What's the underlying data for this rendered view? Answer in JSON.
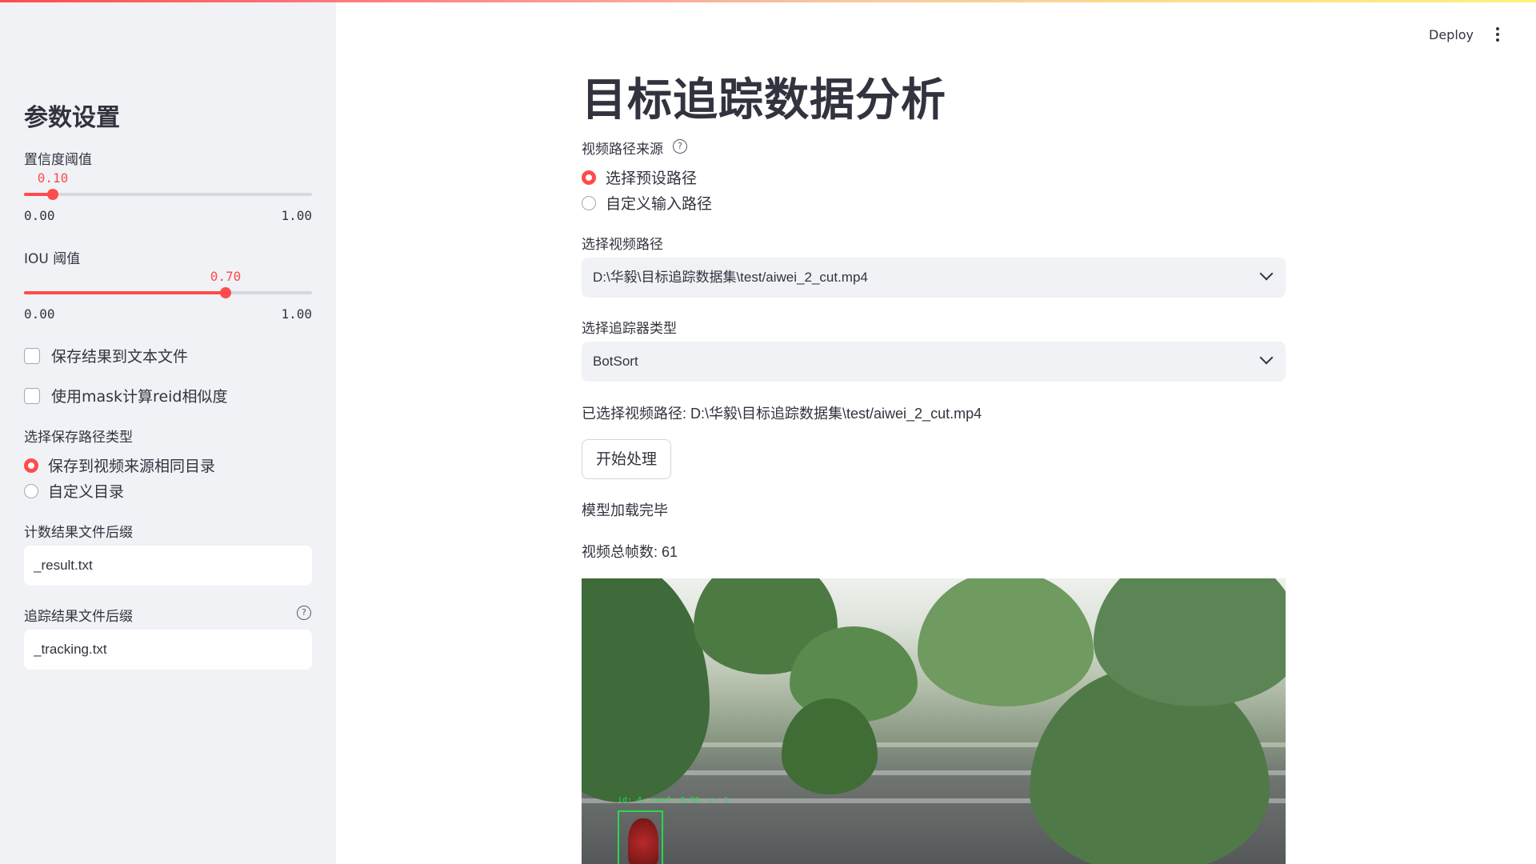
{
  "sidebar": {
    "title": "参数设置",
    "confidence": {
      "label": "置信度阈值",
      "value": 0.1,
      "value_text": "0.10",
      "min_text": "0.00",
      "max_text": "1.00"
    },
    "iou": {
      "label": "IOU 阈值",
      "value": 0.7,
      "value_text": "0.70",
      "min_text": "0.00",
      "max_text": "1.00"
    },
    "checkboxes": [
      {
        "label": "保存结果到文本文件",
        "checked": false
      },
      {
        "label": "使用mask计算reid相似度",
        "checked": false
      }
    ],
    "save_path_type": {
      "label": "选择保存路径类型",
      "options": [
        "保存到视频来源相同目录",
        "自定义目录"
      ],
      "selected": 0
    },
    "count_suffix": {
      "label": "计数结果文件后缀",
      "value": "_result.txt"
    },
    "tracking_suffix": {
      "label": "追踪结果文件后缀",
      "value": "_tracking.txt",
      "help_icon": "question-circle-icon"
    }
  },
  "header": {
    "deploy_label": "Deploy",
    "menu_icon": "more-vertical-icon"
  },
  "main": {
    "title": "目标追踪数据分析",
    "video_source": {
      "label": "视频路径来源",
      "help_icon": "question-circle-icon",
      "options": [
        "选择预设路径",
        "自定义输入路径"
      ],
      "selected": 0
    },
    "video_path_select": {
      "label": "选择视频路径",
      "value": "D:\\华毅\\目标追踪数据集\\test/aiwei_2_cut.mp4"
    },
    "tracker_select": {
      "label": "选择追踪器类型",
      "value": "BotSort"
    },
    "selected_path_text": "已选择视频路径: D:\\华毅\\目标追踪数据集\\test/aiwei_2_cut.mp4",
    "start_button": "开始处理",
    "model_loaded_text": "模型加载完毕",
    "total_frames_text": "视频总帧数: 61",
    "video_frame": {
      "bbox_label": "id: 4, conf: 0.90, c: 1"
    }
  },
  "colors": {
    "accent": "#ff4b4b",
    "sidebar_bg": "#f0f2f6",
    "text": "#31333f",
    "bbox": "#28d94a"
  }
}
